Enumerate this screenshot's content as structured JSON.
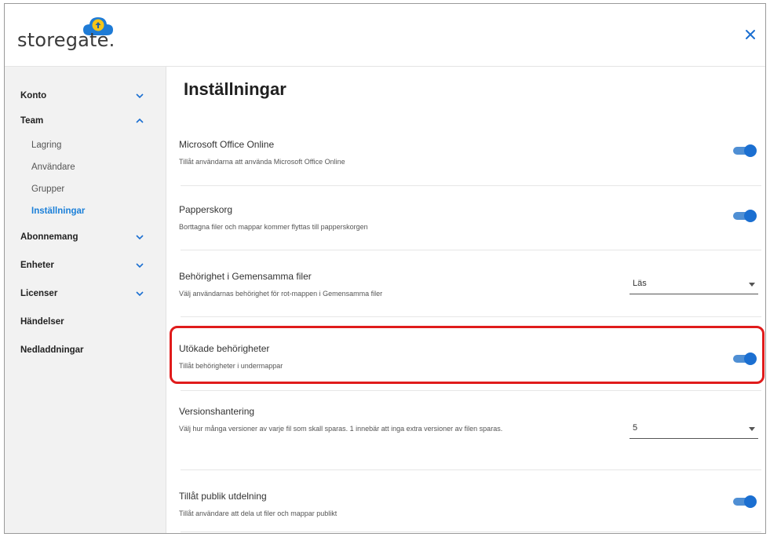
{
  "brand": {
    "logo_text": "storegate."
  },
  "sidebar": {
    "items": [
      {
        "label": "Konto",
        "chevron": "chevron-down"
      },
      {
        "label": "Team",
        "chevron": "chevron-up"
      },
      {
        "label": "Lagring"
      },
      {
        "label": "Användare"
      },
      {
        "label": "Grupper"
      },
      {
        "label": "Inställningar",
        "active": true
      },
      {
        "label": "Abonnemang",
        "chevron": "chevron-down"
      },
      {
        "label": "Enheter",
        "chevron": "chevron-down"
      },
      {
        "label": "Licenser",
        "chevron": "chevron-down"
      },
      {
        "label": "Händelser"
      },
      {
        "label": "Nedladdningar"
      }
    ]
  },
  "main": {
    "title": "Inställningar",
    "settings": [
      {
        "title": "Microsoft Office Online",
        "description": "Tillåt användarna att använda Microsoft Office Online",
        "control": "toggle",
        "enabled": true
      },
      {
        "title": "Papperskorg",
        "description": "Borttagna filer och mappar kommer flyttas till papperskorgen",
        "control": "toggle",
        "enabled": true
      },
      {
        "title": "Behörighet i Gemensamma filer",
        "description": "Välj användarnas behörighet för rot-mappen i Gemensamma filer",
        "control": "select",
        "value": "Läs"
      },
      {
        "title": "Utökade behörigheter",
        "description": "Tillåt behörigheter i undermappar",
        "control": "toggle",
        "enabled": true,
        "highlighted": true
      },
      {
        "title": "Versionshantering",
        "description": "Välj hur många versioner av varje fil som skall sparas. 1 innebär att inga extra versioner av filen sparas.",
        "control": "select",
        "value": "5"
      },
      {
        "title": "Tillåt publik utdelning",
        "description": "Tillåt användare att dela ut filer och mappar publikt",
        "control": "toggle",
        "enabled": true
      }
    ]
  },
  "colors": {
    "accent": "#1b6fd1",
    "highlight": "#e01b1b",
    "active_nav": "#1a7fd8",
    "sidebar_bg": "#f2f2f2",
    "logo_yellow": "#f5c518"
  }
}
